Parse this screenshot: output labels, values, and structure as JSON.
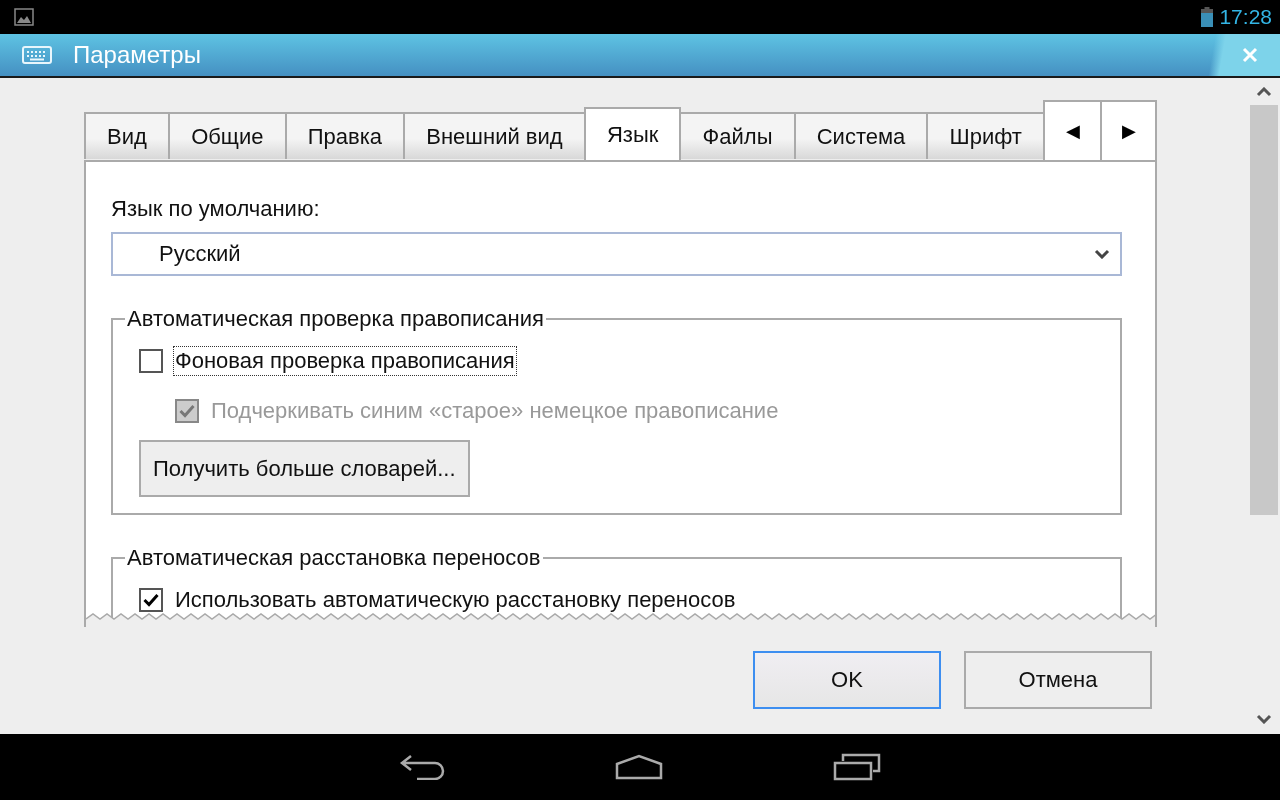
{
  "status_bar": {
    "time": "17:28"
  },
  "window": {
    "title": "Параметры"
  },
  "tabs": [
    {
      "label": "Вид",
      "selected": false
    },
    {
      "label": "Общие",
      "selected": false
    },
    {
      "label": "Правка",
      "selected": false
    },
    {
      "label": "Внешний вид",
      "selected": false
    },
    {
      "label": "Язык",
      "selected": true
    },
    {
      "label": "Файлы",
      "selected": false
    },
    {
      "label": "Система",
      "selected": false
    },
    {
      "label": "Шрифт",
      "selected": false
    }
  ],
  "tab_scroll": [
    "◀",
    "▶"
  ],
  "language": {
    "label": "Язык по умолчанию:",
    "value": "Русский"
  },
  "groups": [
    {
      "title": "Автоматическая проверка правописания",
      "items": [
        {
          "kind": "checkbox",
          "label": "Фоновая проверка правописания",
          "checked": false,
          "disabled": false,
          "focused": true,
          "children": [
            {
              "kind": "checkbox",
              "label": "Подчеркивать синим «старое» немецкое правописание",
              "checked": true,
              "disabled": true,
              "focused": false
            }
          ]
        },
        {
          "kind": "button",
          "label": "Получить больше словарей..."
        }
      ]
    },
    {
      "title": "Автоматическая расстановка переносов",
      "items": [
        {
          "kind": "checkbox",
          "label": "Использовать автоматическую расстановку переносов",
          "checked": true,
          "disabled": false,
          "focused": false
        }
      ]
    }
  ],
  "buttons": [
    {
      "label": "OK",
      "default": true
    },
    {
      "label": "Отмена",
      "default": false
    }
  ]
}
